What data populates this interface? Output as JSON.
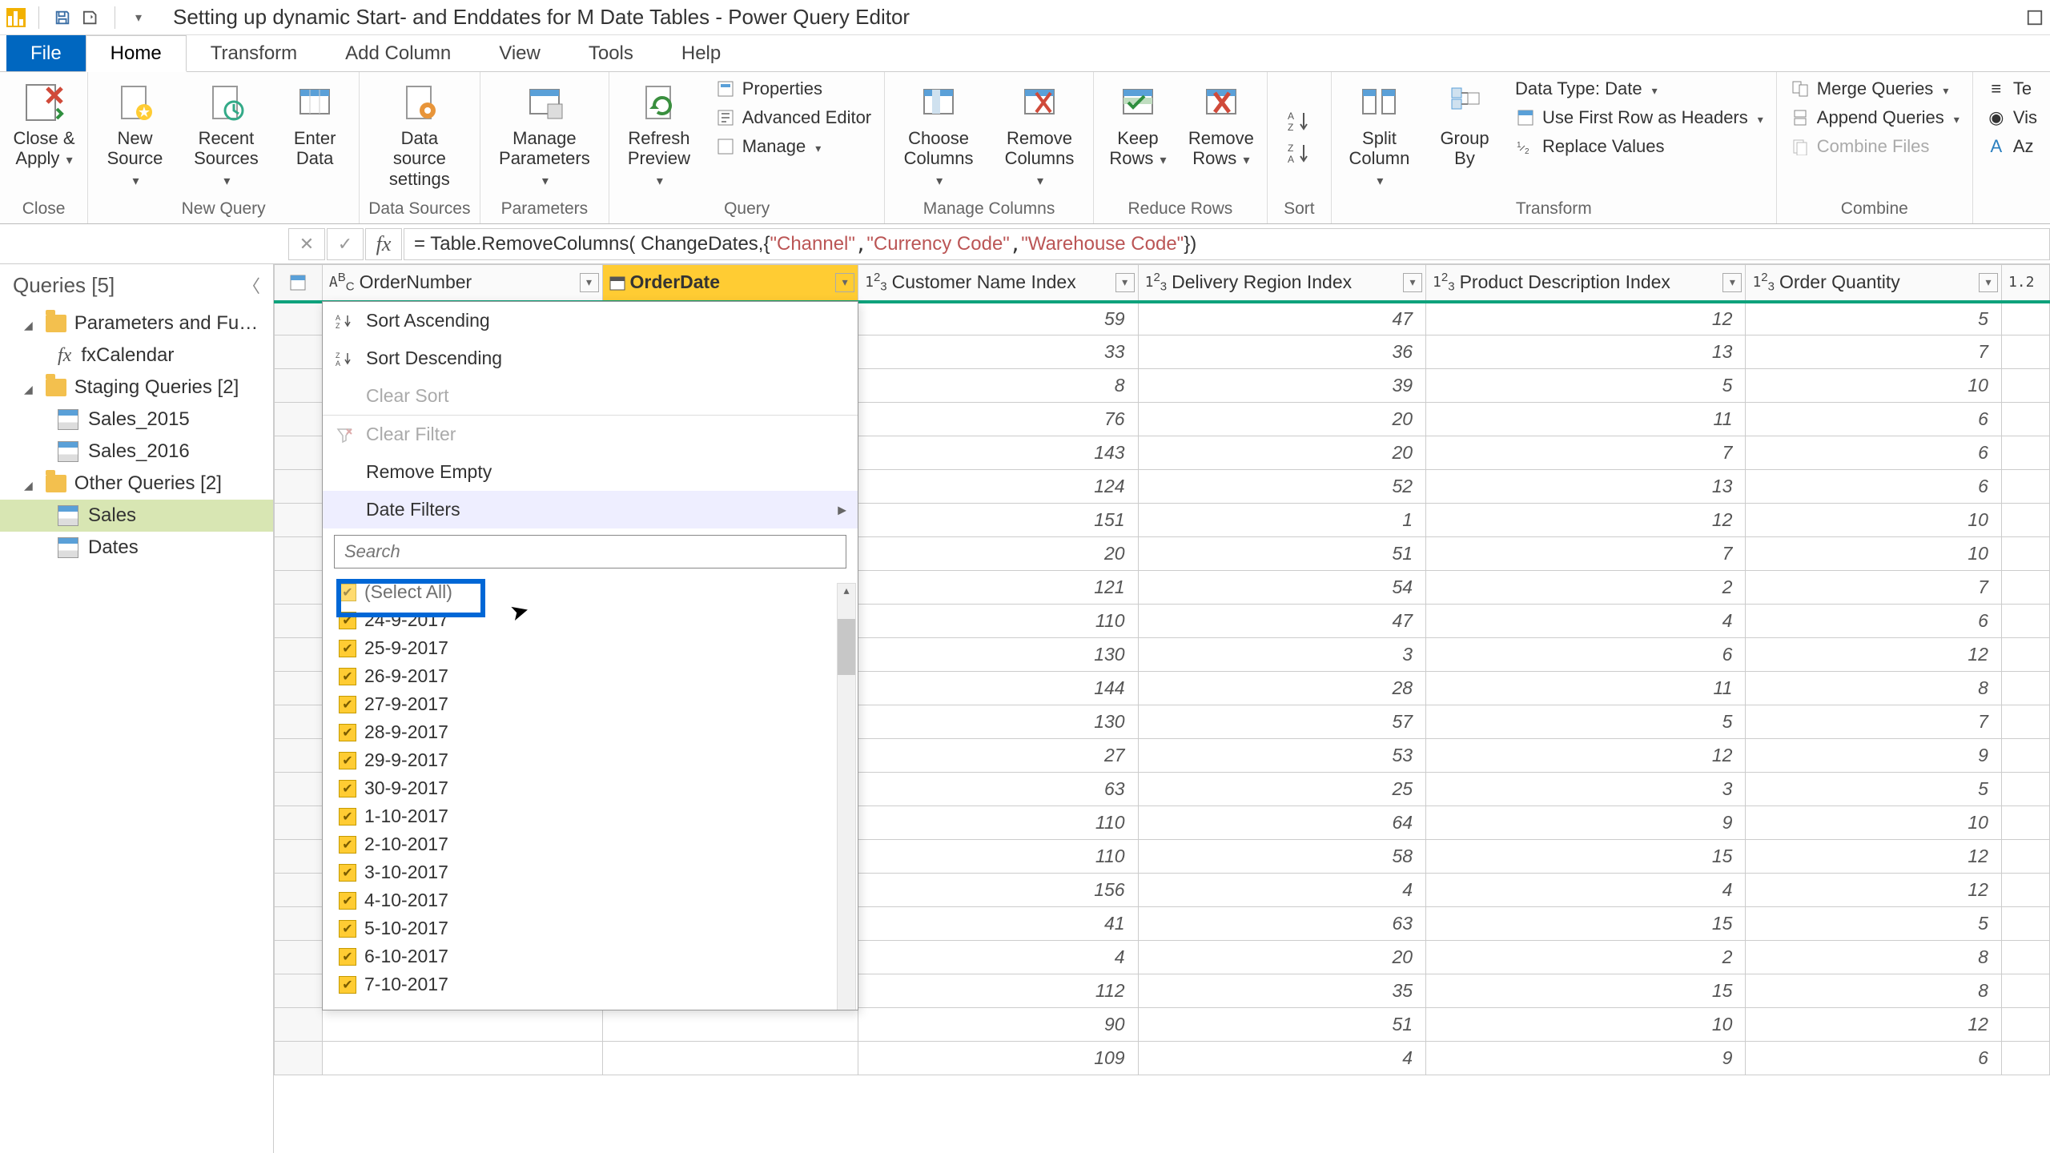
{
  "title": "Setting up dynamic Start- and Enddates for M Date Tables - Power Query Editor",
  "tabs": [
    "File",
    "Home",
    "Transform",
    "Add Column",
    "View",
    "Tools",
    "Help"
  ],
  "ribbon": {
    "close": {
      "btn": "Close &\nApply",
      "label": "Close"
    },
    "newquery": {
      "new": "New\nSource",
      "recent": "Recent\nSources",
      "enter": "Enter\nData",
      "label": "New Query"
    },
    "datasources": {
      "btn": "Data source\nsettings",
      "label": "Data Sources"
    },
    "params": {
      "btn": "Manage\nParameters",
      "label": "Parameters"
    },
    "query": {
      "refresh": "Refresh\nPreview",
      "props": "Properties",
      "adv": "Advanced Editor",
      "manage": "Manage",
      "label": "Query"
    },
    "managecols": {
      "choose": "Choose\nColumns",
      "remove": "Remove\nColumns",
      "label": "Manage Columns"
    },
    "reducerows": {
      "keep": "Keep\nRows",
      "del": "Remove\nRows",
      "label": "Reduce Rows"
    },
    "sort": {
      "label": "Sort"
    },
    "transform": {
      "split": "Split\nColumn",
      "group": "Group\nBy",
      "datatype": "Data Type: Date",
      "firstrow": "Use First Row as Headers",
      "replace": "Replace Values",
      "label": "Transform"
    },
    "combine": {
      "merge": "Merge Queries",
      "append": "Append Queries",
      "files": "Combine Files",
      "label": "Combine"
    },
    "ai": {
      "ta": "Te",
      "vis": "Vis",
      "az": "Az"
    }
  },
  "formula_prefix": "= Table.RemoveColumns( ChangeDates,{",
  "formula_strs": [
    "\"Channel\"",
    "\"Currency Code\"",
    "\"Warehouse Code\""
  ],
  "formula_suffix": "})",
  "queries_header": "Queries [5]",
  "queries": {
    "g1": "Parameters and Fu…",
    "fx": "fxCalendar",
    "g2": "Staging Queries [2]",
    "s2015": "Sales_2015",
    "s2016": "Sales_2016",
    "g3": "Other Queries [2]",
    "sales": "Sales",
    "dates": "Dates"
  },
  "columns": {
    "ordnum": "OrderNumber",
    "orddate": "OrderDate",
    "cust": "Customer Name Index",
    "region": "Delivery Region Index",
    "prod": "Product Description Index",
    "qty": "Order Quantity"
  },
  "filter": {
    "sort_asc": "Sort Ascending",
    "sort_desc": "Sort Descending",
    "clear_sort": "Clear Sort",
    "clear_filter": "Clear Filter",
    "remove_empty": "Remove Empty",
    "date_filters": "Date Filters",
    "search_ph": "Search",
    "select_all": "(Select All)",
    "dates": [
      "24-9-2017",
      "25-9-2017",
      "26-9-2017",
      "27-9-2017",
      "28-9-2017",
      "29-9-2017",
      "30-9-2017",
      "1-10-2017",
      "2-10-2017",
      "3-10-2017",
      "4-10-2017",
      "5-10-2017",
      "6-10-2017",
      "7-10-2017"
    ]
  },
  "chart_data": {
    "type": "table",
    "columns": [
      "Customer Name Index",
      "Delivery Region Index",
      "Product Description Index",
      "Order Quantity"
    ],
    "rows": [
      [
        59,
        47,
        12,
        5
      ],
      [
        33,
        36,
        13,
        7
      ],
      [
        8,
        39,
        5,
        10
      ],
      [
        76,
        20,
        11,
        6
      ],
      [
        143,
        20,
        7,
        6
      ],
      [
        124,
        52,
        13,
        6
      ],
      [
        151,
        1,
        12,
        10
      ],
      [
        20,
        51,
        7,
        10
      ],
      [
        121,
        54,
        2,
        7
      ],
      [
        110,
        47,
        4,
        6
      ],
      [
        130,
        3,
        6,
        12
      ],
      [
        144,
        28,
        11,
        8
      ],
      [
        130,
        57,
        5,
        7
      ],
      [
        27,
        53,
        12,
        9
      ],
      [
        63,
        25,
        3,
        5
      ],
      [
        110,
        64,
        9,
        10
      ],
      [
        110,
        58,
        15,
        12
      ],
      [
        156,
        4,
        4,
        12
      ],
      [
        41,
        63,
        15,
        5
      ],
      [
        4,
        20,
        2,
        8
      ],
      [
        112,
        35,
        15,
        8
      ],
      [
        90,
        51,
        10,
        12
      ],
      [
        109,
        4,
        9,
        6
      ]
    ]
  },
  "partial_col": "1.2"
}
